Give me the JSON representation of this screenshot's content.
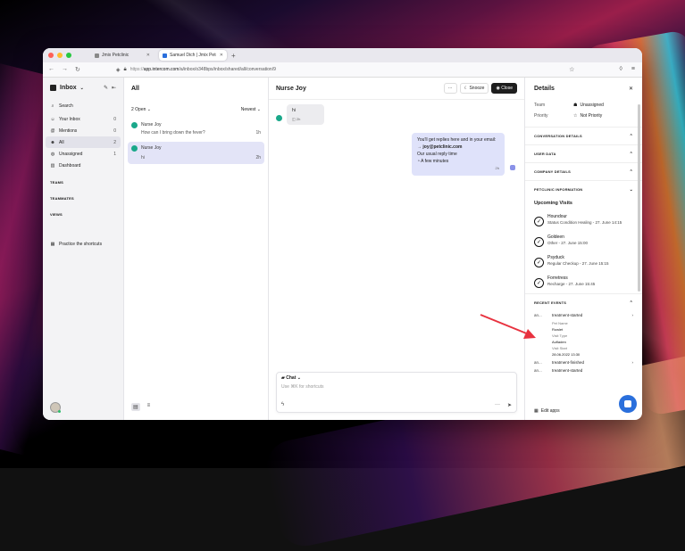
{
  "browser": {
    "tabs": [
      {
        "label": "Jmix Petclinic",
        "active": false
      },
      {
        "label": "Samuel Dich | Jmix Petclinic | Inter",
        "active": true
      }
    ],
    "url_prefix": "https://",
    "url_host": "app.intercom.com",
    "url_path": "/a/inbox/o348bps/inbox/shared/all/conversation/9"
  },
  "nav": {
    "title": "Inbox",
    "items": [
      {
        "label": "Search",
        "count": "",
        "icon": "search-icon"
      },
      {
        "label": "Your Inbox",
        "count": "0",
        "icon": "inbox-icon"
      },
      {
        "label": "Mentions",
        "count": "0",
        "icon": "at-icon"
      },
      {
        "label": "All",
        "count": "2",
        "icon": "users-icon"
      },
      {
        "label": "Unassigned",
        "count": "1",
        "icon": "user-icon"
      },
      {
        "label": "Dashboard",
        "count": "",
        "icon": "chart-icon"
      }
    ],
    "sections": [
      "TEAMS",
      "TEAMMATES",
      "VIEWS"
    ],
    "shortcuts": "Practice the shortcuts"
  },
  "list": {
    "title": "All",
    "filter_left": "2 Open",
    "filter_right": "Newest",
    "conversations": [
      {
        "name": "Nurse Joy",
        "message": "How can I bring down the fever?",
        "time": "1h",
        "selected": false
      },
      {
        "name": "Nurse Joy",
        "message": "hi",
        "time": "2h",
        "selected": true
      }
    ]
  },
  "chat": {
    "title": "Nurse Joy",
    "more": "···",
    "snooze": "Snooze",
    "close": "Close",
    "incoming": {
      "text": "hi",
      "meta": "2h"
    },
    "outgoing": {
      "line1": "You'll get replies here and in your email:",
      "line2": "→ joy@petclinic.com",
      "line3": "Our usual reply time",
      "line4": "◔ A few minutes",
      "meta": "2h"
    },
    "composer": {
      "mode": "Chat",
      "placeholder": "Use ⌘K for shortcuts"
    }
  },
  "details": {
    "title": "Details",
    "team_label": "Team",
    "team_value": "Unassigned",
    "priority_label": "Priority",
    "priority_value": "Not Priority",
    "sections": [
      "CONVERSATION DETAILS",
      "USER DATA",
      "COMPANY DETAILS",
      "PETCLINIC INFORMATION"
    ],
    "upcoming_title": "Upcoming Visits",
    "visits": [
      {
        "name": "Houndour",
        "desc": "Status Condition Healing - 27. June 14:15"
      },
      {
        "name": "Goldeen",
        "desc": "Other - 27. June 15:00"
      },
      {
        "name": "Psyduck",
        "desc": "Regular Checkup - 27. June 15:15"
      },
      {
        "name": "Forretress",
        "desc": "Recharge - 27. June 15:45"
      }
    ],
    "recent_title": "RECENT EVENTS",
    "events": [
      {
        "who": "an...",
        "name": "treatment-started"
      },
      {
        "who": "an...",
        "name": "treatment-finished"
      },
      {
        "who": "an...",
        "name": "treatment-started"
      }
    ],
    "event_detail": {
      "pet_name_label": "Pet Name",
      "pet_name": "Rowlet",
      "visit_type_label": "Visit Type",
      "visit_type": "Aufladen",
      "visit_start_label": "Visit Start",
      "visit_start": "28.06.2022 13:30"
    },
    "edit_apps": "Edit apps"
  }
}
